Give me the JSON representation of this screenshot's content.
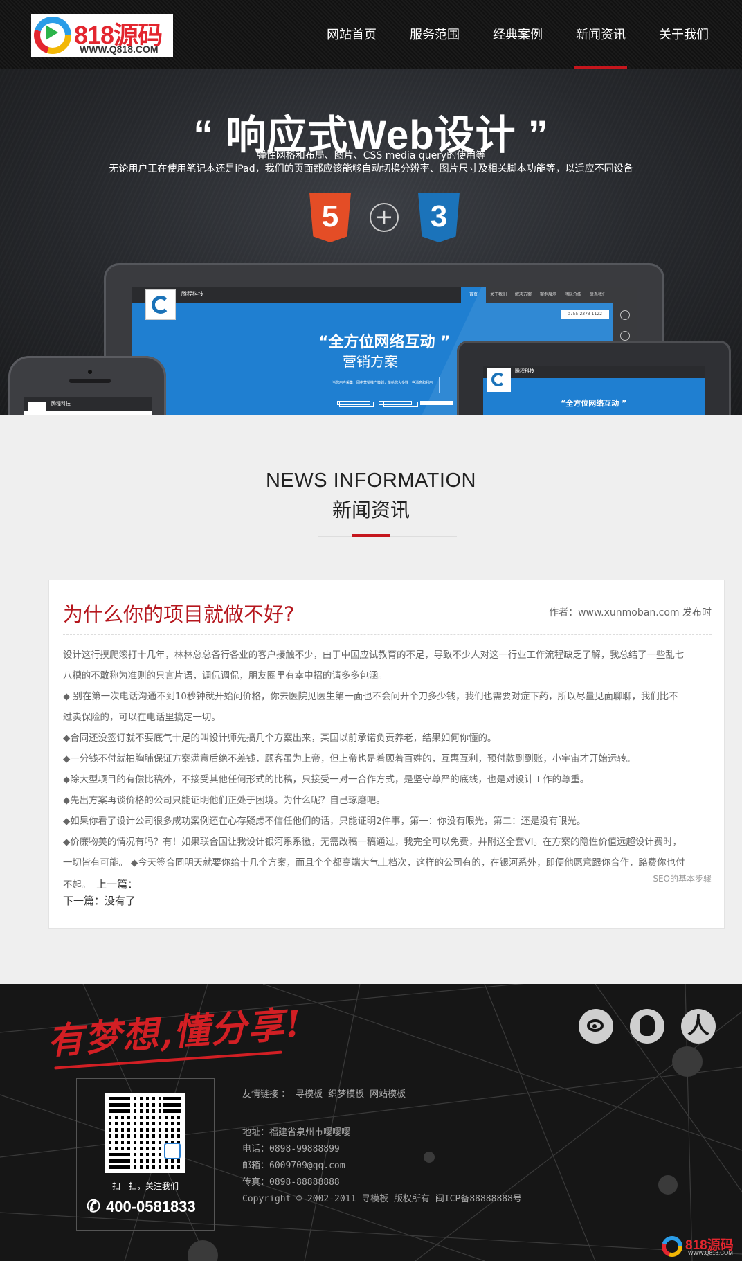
{
  "header": {
    "logo_text": "818源码",
    "logo_url": "WWW.Q818.COM",
    "nav": [
      {
        "label": "网站首页",
        "active": false
      },
      {
        "label": "服务范围",
        "active": false
      },
      {
        "label": "经典案例",
        "active": false
      },
      {
        "label": "新闻资讯",
        "active": true
      },
      {
        "label": "关于我们",
        "active": false
      }
    ]
  },
  "banner": {
    "title": "“ 响应式Web设计 ”",
    "subtitle1": "弹性网格和布局、图片、CSS media query的使用等",
    "subtitle2": "无论用户正在使用笔记本还是iPad，我们的页面都应该能够自动切换分辨率、图片尺寸及相关脚本功能等，以适应不同设备",
    "html5_glyph": "5",
    "css3_glyph": "3",
    "plus": "+",
    "mock_brand": "腾程科技",
    "mock_nav": [
      "首页",
      "关于我们",
      "解决方案",
      "案例展示",
      "团队介绍",
      "联系我们"
    ],
    "mock_phone": "0755-2373 1122",
    "mock_headline": "“全方位网络互动 ”",
    "mock_headline2": "营销方案",
    "mock_box_text": "当您用户采集，网络营销推广策划，能给您大多数一些消息和利用",
    "tablet_headline": "“全方位网络互动 ”",
    "slides": [
      true,
      true,
      false
    ]
  },
  "news": {
    "title_en": "NEWS INFORMATION",
    "title_cn": "新闻资讯"
  },
  "article": {
    "title": "为什么你的项目就做不好?",
    "meta": "作者：www.xunmoban.com 发布时",
    "paragraphs": [
      "设计这行摸爬滚打十几年，林林总总各行各业的客户接触不少，由于中国应试教育的不足，导致不少人对这一行业工作流程缺乏了解，我总结了一些乱七",
      "八糟的不敢称为准则的只言片语，调侃调侃，朋友圈里有幸中招的请多多包涵。",
      "◆ 别在第一次电话沟通不到10秒钟就开始问价格，你去医院见医生第一面也不会问开个刀多少钱，我们也需要对症下药，所以尽量见面聊聊，我们比不",
      "过卖保险的，可以在电话里搞定一切。",
      "◆合同还没签订就不要底气十足的叫设计师先搞几个方案出来，某国以前承诺负责养老，结果如何你懂的。",
      "◆一分钱不付就拍胸脯保证方案满意后绝不差钱，顾客虽为上帝，但上帝也是着顾着百姓的，互惠互利，预付款到到账，小宇宙才开始运转。",
      "◆除大型项目的有偿比稿外，不接受其他任何形式的比稿，只接受一对一合作方式，是坚守尊严的底线，也是对设计工作的尊重。",
      "◆先出方案再谈价格的公司只能证明他们正处于困境。为什么呢？自己琢磨吧。",
      "◆如果你看了设计公司很多成功案例还在心存疑虑不信任他们的话，只能证明2件事，第一：你没有眼光，第二：还是没有眼光。",
      "◆价廉物美的情况有吗？有！如果联合国让我设计银河系系徽，无需改稿一稿通过，我完全可以免费，并附送全套VI。在方案的隐性价值远超设计费时，",
      "一切皆有可能。 ◆今天签合同明天就要你给十几个方案，而且个个都高端大气上档次，这样的公司有的，在银河系外，即便他愿意跟你合作，路费你也付"
    ],
    "last_line": "不起。",
    "prev_label": "上一篇：",
    "seo_tag": "SEO的基本步骤",
    "next_label": "下一篇：没有了"
  },
  "footer": {
    "slogan": "有梦想,懂分享!",
    "social": [
      "weibo",
      "qq",
      "renren"
    ],
    "qr_caption": "扫一扫，关注我们",
    "hotline": "400-0581833",
    "friend_links_label": "友情链接 ：",
    "friend_links": [
      "寻模板",
      "织梦模板",
      "网站模板"
    ],
    "address": "地址：福建省泉州市嘤嘤嘤",
    "phone": "电话：0898-99888899",
    "email": "邮箱：6009709@qq.com",
    "fax": "传真：0898-88888888",
    "copyright": "Copyright © 2002-2011 寻模板 版权所有  闽ICP备88888888号",
    "corner_logo": "818源码",
    "corner_url": "WWW.Q818.COM"
  },
  "colors": {
    "accent": "#c5161d",
    "header_bg": "#151515",
    "footer_bg": "#161616",
    "page_bg": "#efefef",
    "title_red": "#b5161d"
  }
}
